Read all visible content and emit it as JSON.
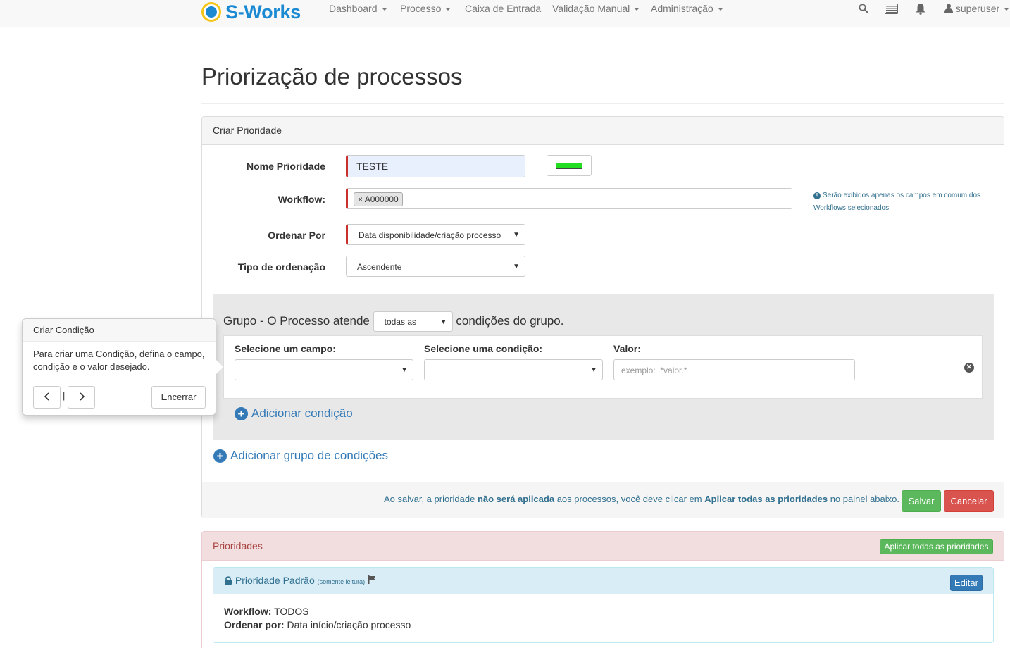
{
  "navbar": {
    "brand": "S-Works",
    "items": [
      {
        "label": "Dashboard",
        "dropdown": true
      },
      {
        "label": "Processo",
        "dropdown": true
      },
      {
        "label": "Caixa de Entrada",
        "dropdown": false
      },
      {
        "label": "Validação Manual",
        "dropdown": true
      },
      {
        "label": "Administração",
        "dropdown": true
      }
    ],
    "user": "superuser"
  },
  "page": {
    "title": "Priorização de processos"
  },
  "form": {
    "heading": "Criar Prioridade",
    "nome_label": "Nome Prioridade",
    "nome_value": "TESTE",
    "color_swatch": "#22dd22",
    "workflow_label": "Workflow:",
    "workflow_tag": "A000000",
    "workflow_tag_remove": "×",
    "workflow_help": "Serão exibidos apenas os campos em comum dos Workflows selecionados",
    "ordenar_label": "Ordenar Por",
    "ordenar_value": "Data disponibilidade/criação processo",
    "tipo_label": "Tipo de ordenação",
    "tipo_value": "Ascendente"
  },
  "group": {
    "prefix": "Grupo - O Processo atende",
    "select_value": "todas as",
    "suffix": "condições do grupo.",
    "campo_label": "Selecione um campo:",
    "condicao_label": "Selecione uma condição:",
    "valor_label": "Valor:",
    "valor_placeholder": "exemplo: .*valor.*",
    "add_condition": "Adicionar condição",
    "add_group": "Adicionar grupo de condições"
  },
  "footer": {
    "note_1": "Ao salvar, a prioridade ",
    "note_bold_1": "não será aplicada",
    "note_2": " aos processos, você deve clicar em ",
    "note_bold_2": "Aplicar todas as prioridades",
    "note_3": " no painel abaixo.",
    "save": "Salvar",
    "cancel": "Cancelar"
  },
  "prioridades": {
    "heading": "Prioridades",
    "apply_all": "Aplicar todas as prioridades",
    "default_name": "Prioridade Padrão",
    "readonly": "(somente leitura)",
    "edit": "Editar",
    "workflow_label": "Workflow:",
    "workflow_value": " TODOS",
    "ordenar_label": "Ordenar por:",
    "ordenar_value": " Data início/criação processo"
  },
  "popover": {
    "title": "Criar Condição",
    "content": "Para criar uma Condição, defina o campo, condição e o valor desejado.",
    "separator": "|",
    "close": "Encerrar"
  }
}
